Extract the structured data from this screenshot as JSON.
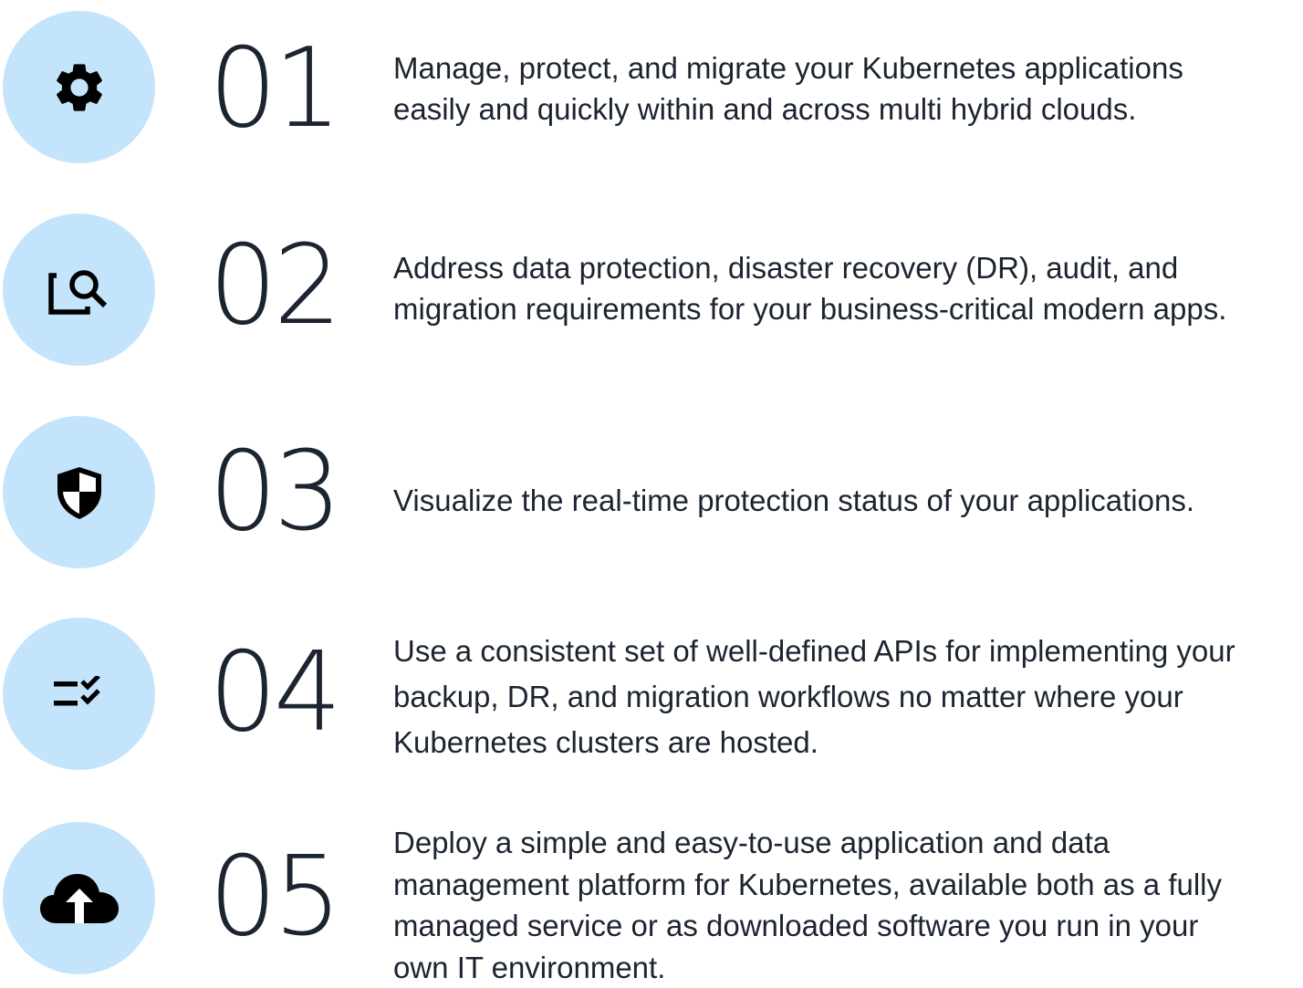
{
  "items": [
    {
      "number": "01",
      "icon": "gear-icon",
      "lines": [
        "Manage, protect, and migrate your Kubernetes applications",
        "easily and quickly within and across multi hybrid clouds."
      ]
    },
    {
      "number": "02",
      "icon": "search-frame-icon",
      "lines": [
        "Address data protection, disaster recovery (DR), audit, and",
        "migration requirements for your business-critical modern apps."
      ]
    },
    {
      "number": "03",
      "icon": "shield-icon",
      "lines": [
        "Visualize the real-time protection status of your applications."
      ]
    },
    {
      "number": "04",
      "icon": "checklist-icon",
      "lines": [
        "Use a consistent set of well-defined APIs for implementing your",
        "backup, DR, and migration workflows no matter where your",
        "Kubernetes clusters are hosted."
      ]
    },
    {
      "number": "05",
      "icon": "cloud-upload-icon",
      "lines": [
        "Deploy a simple and easy-to-use application and data",
        "management platform for Kubernetes, available both as a fully",
        "managed service or as downloaded software you run in your",
        "own IT environment."
      ]
    }
  ],
  "colors": {
    "circle": "#c3e4fb",
    "ink": "#1b2430"
  }
}
